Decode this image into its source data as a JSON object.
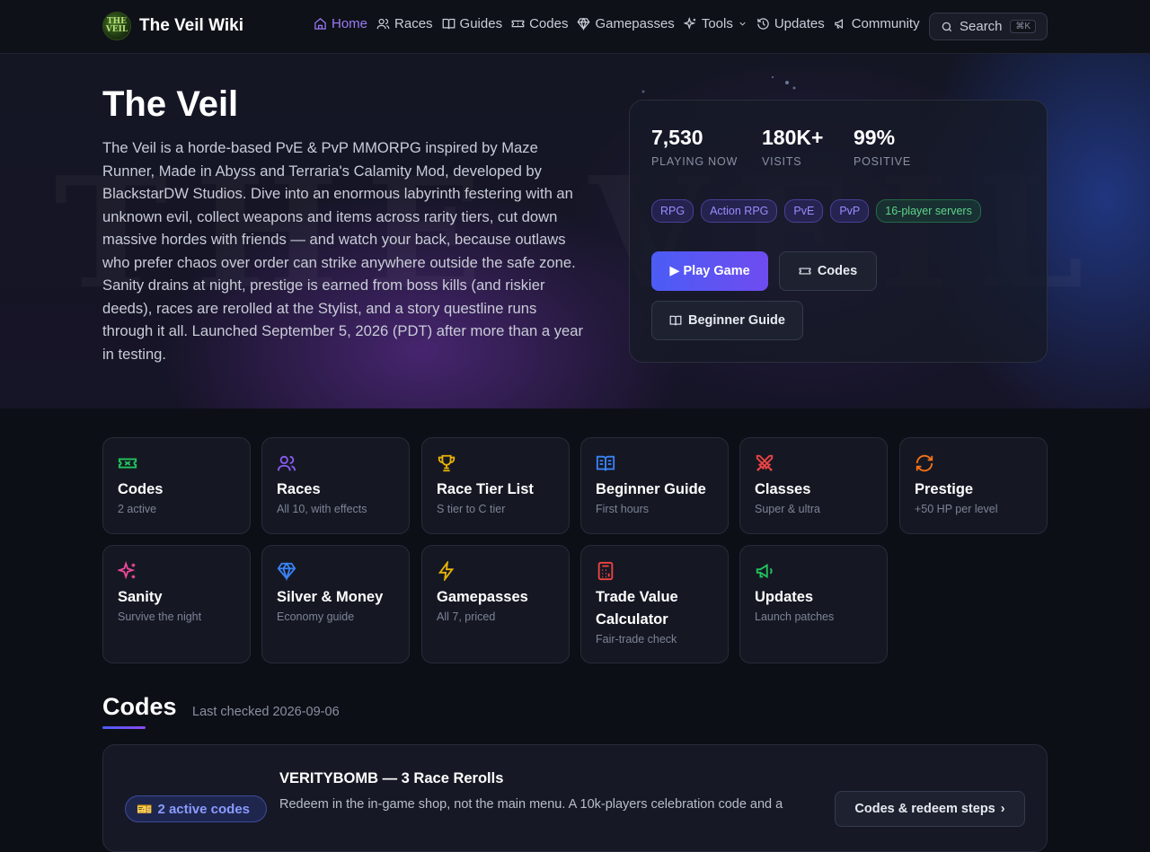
{
  "nav": {
    "brand": "The Veil Wiki",
    "logo_text": "THE VEIL",
    "links": [
      {
        "label": "Home",
        "icon": "home-icon",
        "active": true
      },
      {
        "label": "Races",
        "icon": "users-icon"
      },
      {
        "label": "Guides",
        "icon": "book-icon"
      },
      {
        "label": "Codes",
        "icon": "ticket-icon"
      },
      {
        "label": "Gamepasses",
        "icon": "diamond-icon"
      },
      {
        "label": "Tools",
        "icon": "sparkles-icon",
        "dropdown": true
      },
      {
        "label": "Updates",
        "icon": "history-icon"
      },
      {
        "label": "Community",
        "icon": "megaphone-icon"
      }
    ],
    "search_label": "Search",
    "search_shortcut": "⌘K"
  },
  "hero": {
    "background_text": "THE VEIL",
    "title": "The Veil",
    "description": "The Veil is a horde-based PvE & PvP MMORPG inspired by Maze Runner, Made in Abyss and Terraria's Calamity Mod, developed by BlackstarDW Studios. Dive into an enormous labyrinth festering with an unknown evil, collect weapons and items across rarity tiers, cut down massive hordes with friends — and watch your back, because outlaws who prefer chaos over order can strike anywhere outside the safe zone. Sanity drains at night, prestige is earned from boss kills (and riskier deeds), races are rerolled at the Stylist, and a story questline runs through it all. Launched September 5, 2026 (PDT) after more than a year in testing.",
    "stats": [
      {
        "value": "7,530",
        "label": "PLAYING NOW"
      },
      {
        "value": "180K+",
        "label": "VISITS"
      },
      {
        "value": "99%",
        "label": "POSITIVE"
      }
    ],
    "tags": [
      {
        "label": "RPG",
        "style": "purple"
      },
      {
        "label": "Action RPG",
        "style": "purple"
      },
      {
        "label": "PvE",
        "style": "purple"
      },
      {
        "label": "PvP",
        "style": "purple"
      },
      {
        "label": "16-player servers",
        "style": "green"
      }
    ],
    "buttons": {
      "play": "▶ Play Game",
      "codes": "Codes",
      "guide": "Beginner Guide"
    }
  },
  "quick_links": [
    {
      "title": "Codes",
      "subtitle": "2 active",
      "icon": "ticket-icon",
      "color": "#22c55e"
    },
    {
      "title": "Races",
      "subtitle": "All 10, with effects",
      "icon": "users-icon",
      "color": "#8b5cf6"
    },
    {
      "title": "Race Tier List",
      "subtitle": "S tier to C tier",
      "icon": "trophy-icon",
      "color": "#eab308"
    },
    {
      "title": "Beginner Guide",
      "subtitle": "First hours",
      "icon": "book-icon",
      "color": "#3b82f6"
    },
    {
      "title": "Classes",
      "subtitle": "Super & ultra",
      "icon": "swords-icon",
      "color": "#ef4444"
    },
    {
      "title": "Prestige",
      "subtitle": "+50 HP per level",
      "icon": "refresh-icon",
      "color": "#f97316"
    },
    {
      "title": "Sanity",
      "subtitle": "Survive the night",
      "icon": "sparkles-icon",
      "color": "#ec4899"
    },
    {
      "title": "Silver & Money",
      "subtitle": "Economy guide",
      "icon": "diamond-icon",
      "color": "#3b82f6"
    },
    {
      "title": "Gamepasses",
      "subtitle": "All 7, priced",
      "icon": "bolt-icon",
      "color": "#eab308"
    },
    {
      "title": "Trade Value Calculator",
      "subtitle": "Fair-trade check",
      "icon": "calculator-icon",
      "color": "#ef4444"
    },
    {
      "title": "Updates",
      "subtitle": "Launch patches",
      "icon": "megaphone-icon",
      "color": "#22c55e"
    }
  ],
  "codes_section": {
    "heading": "Codes",
    "last_checked": "Last checked 2026-09-06",
    "active_badge": "2 active codes",
    "featured_title": "VERITYBOMB — 3 Race Rerolls",
    "featured_desc": "Redeem in the in-game shop, not the main menu. A 10k-players celebration code and a",
    "button": "Codes & redeem steps"
  }
}
